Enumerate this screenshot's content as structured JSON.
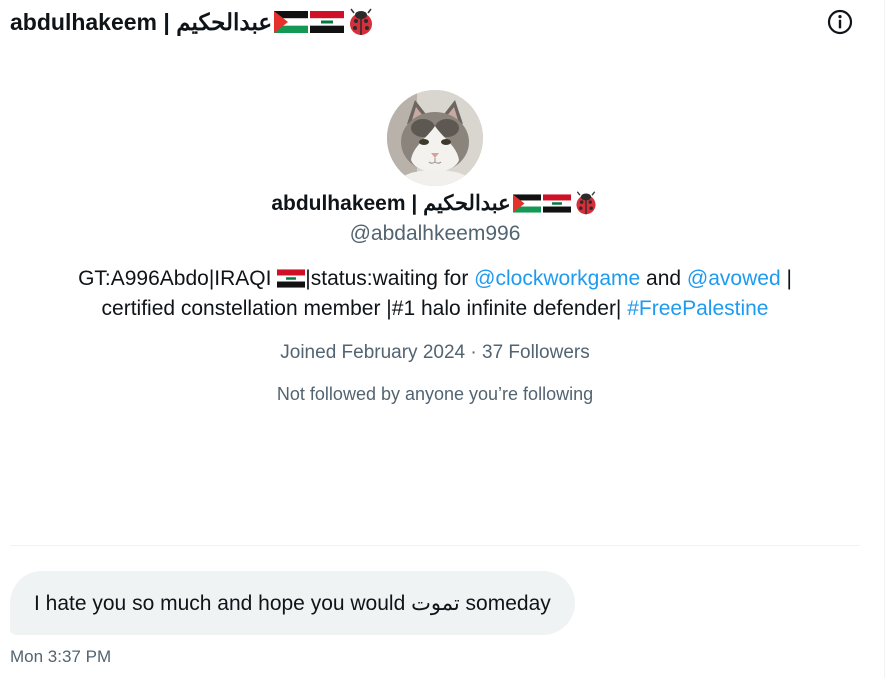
{
  "header": {
    "display_name": "abdulhakeem | عبدالحكيم"
  },
  "profile": {
    "display_name": "abdulhakeem | عبدالحكيم",
    "handle": "@abdalhkeem996",
    "bio": {
      "line1_part1": "GT:A996Abdo|IRAQI ",
      "line1_part2": "|status:waiting for ",
      "mention1": "@clockworkgame",
      "and_text": " and ",
      "mention2": "@avowed",
      "line1_end": " |",
      "line2_text": "certified constellation member |#1 halo infinite defender| ",
      "hashtag": "#FreePalestine"
    },
    "joined": "Joined February 2024",
    "separator": "·",
    "followers": "37 Followers",
    "not_followed_text": "Not followed by anyone you’re following"
  },
  "message": {
    "text": "I hate you so much and hope you would تموت someday",
    "timestamp": "Mon 3:37 PM"
  },
  "icons": {
    "info": "info-circle-icon",
    "flag_palestine": "palestine-flag-icon",
    "flag_iraq": "iraq-flag-icon",
    "ladybug": "ladybug-icon"
  },
  "colors": {
    "link": "#1d9bf0",
    "secondary_text": "#536471",
    "bubble_bg": "#eff3f4"
  }
}
